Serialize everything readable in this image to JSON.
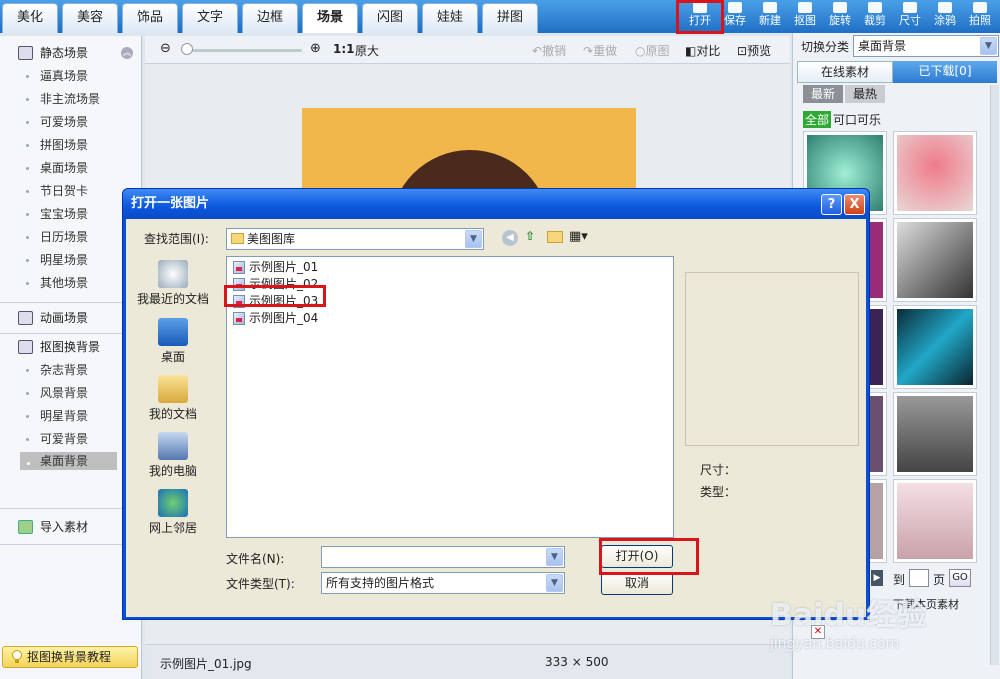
{
  "tabs": [
    "美化",
    "美容",
    "饰品",
    "文字",
    "边框",
    "场景",
    "闪图",
    "娃娃",
    "拼图"
  ],
  "tools": [
    "打开",
    "保存",
    "新建",
    "抠图",
    "旋转",
    "裁剪",
    "尺寸",
    "涂鸦",
    "拍照"
  ],
  "sidebar": {
    "static_section": "静态场景",
    "static_items": [
      "逼真场景",
      "非主流场景",
      "可爱场景",
      "拼图场景",
      "桌面场景",
      "节日贺卡",
      "宝宝场景",
      "日历场景",
      "明星场景",
      "其他场景"
    ],
    "anim_section": "动画场景",
    "cutout_section": "抠图换背景",
    "cutout_items": [
      "杂志背景",
      "风景背景",
      "明星背景",
      "可爱背景",
      "桌面背景"
    ],
    "import": "导入素材",
    "tutorial": "抠图换背景教程"
  },
  "canvas_toolbar": {
    "zoom": "1:1",
    "original_size": "原大",
    "undo": "撤销",
    "redo": "重做",
    "original": "原图",
    "compare": "对比",
    "preview": "预览"
  },
  "status": {
    "filename": "示例图片_01.jpg",
    "dimensions": "333 × 500"
  },
  "right_panel": {
    "category_label": "切换分类",
    "category_value": "桌面背景",
    "tab_online": "在线素材",
    "tab_downloaded": "已下载[0]",
    "sort_new": "最新",
    "sort_hot": "最热",
    "tag_all": "全部",
    "tag_name": "可口可乐",
    "goto": "到",
    "page": "页",
    "go": "GO",
    "download_page": "下载本页素材"
  },
  "dialog": {
    "title": "打开一张图片",
    "lookin_label": "查找范围(I):",
    "lookin_value": "美图图库",
    "places": [
      "我最近的文档",
      "桌面",
      "我的文档",
      "我的电脑",
      "网上邻居"
    ],
    "files": [
      "示例图片_01",
      "示例图片_02",
      "示例图片_03",
      "示例图片_04"
    ],
    "filename_label": "文件名(N):",
    "filename_value": "",
    "filetype_label": "文件类型(T):",
    "filetype_value": "所有支持的图片格式",
    "open_btn": "打开(O)",
    "cancel_btn": "取消",
    "size_label": "尺寸：",
    "type_label": "类型：",
    "help": "?",
    "close": "X"
  },
  "watermark": {
    "brand": "Baidu经验",
    "url": "jingyan.baidu.com"
  }
}
